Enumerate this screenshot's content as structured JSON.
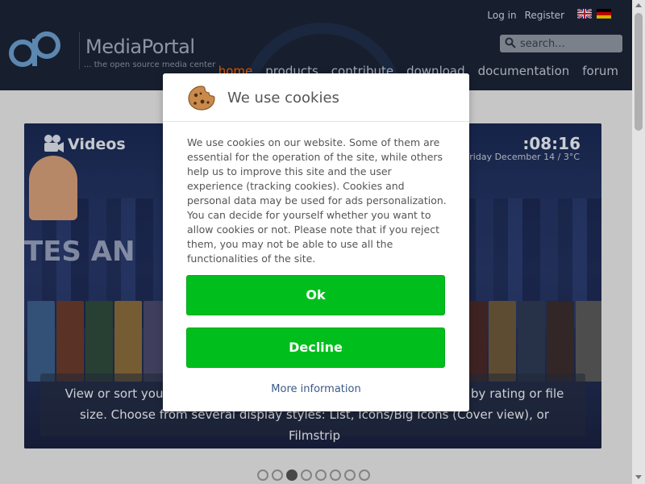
{
  "header": {
    "logo_text": "MediaPortal",
    "logo_tagline": "... the open source media center",
    "auth": {
      "login": "Log in",
      "register": "Register"
    },
    "languages": [
      "en-flag",
      "de-flag"
    ],
    "search": {
      "placeholder": "search...",
      "value": "",
      "icon": "search-icon"
    },
    "nav": [
      "home",
      "products",
      "contribute",
      "download",
      "documentation",
      "forum"
    ],
    "active_nav": "home",
    "colors": {
      "background": "#1c2436",
      "active_nav": "#ff6a00"
    }
  },
  "slider": {
    "title": "Videos",
    "title_icon": "film-camera-icon",
    "clock": ":08:16",
    "date": "Friday December 14 / 3°C",
    "poster_text": "TES AN",
    "caption": "View or sort your media by name, date, year or file size. Then sort by rating or file size. Choose from several display styles: List, Icons/Big Icons (Cover view), or Filmstrip",
    "slide_count": 8,
    "active_slide": 3
  },
  "cookie_dialog": {
    "icon": "cookie-icon",
    "title": "We use cookies",
    "body": "We use cookies on our website. Some of them are essential for the operation of the site, while others help us to improve this site and the user experience (tracking cookies). Cookies and personal data may be used for ads personalization. You can decide for yourself whether you want to allow cookies or not. Please note that if you reject them, you may not be able to use all the functionalities of the site.",
    "ok_label": "Ok",
    "decline_label": "Decline",
    "more_info_label": "More information",
    "colors": {
      "button": "#00bf1c",
      "link": "#3a5a86"
    }
  }
}
